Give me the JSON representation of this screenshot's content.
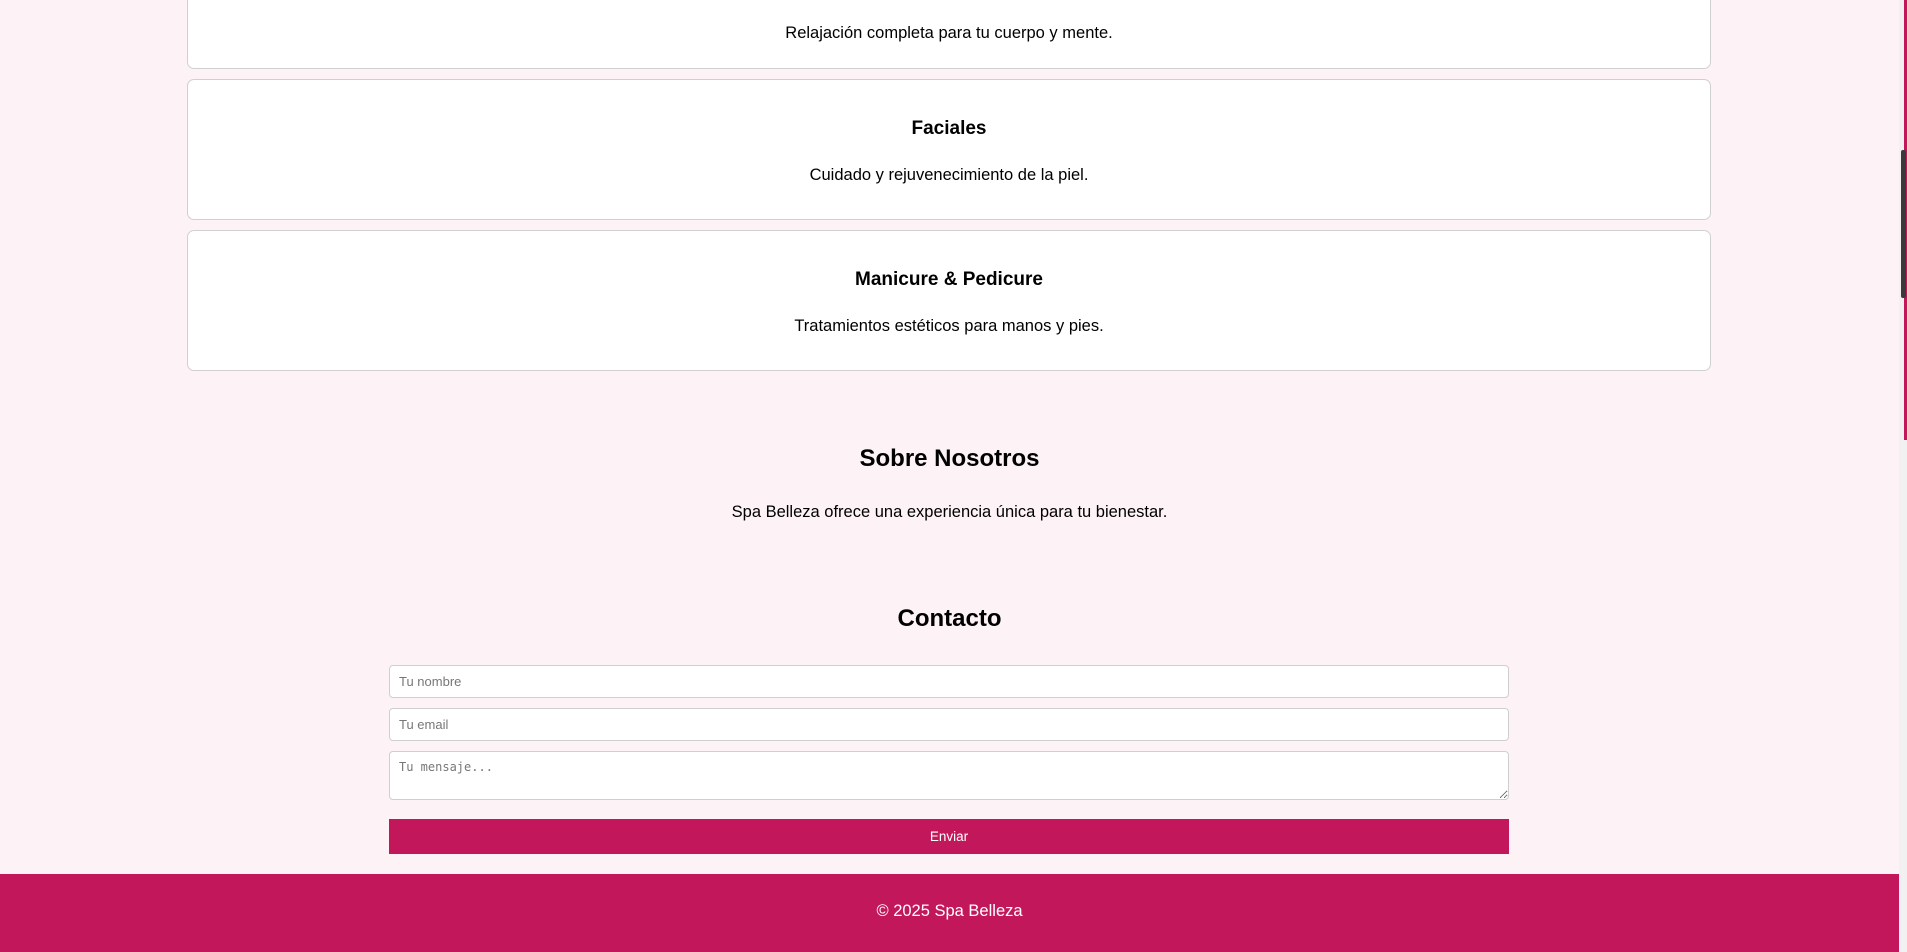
{
  "services": [
    {
      "title": "",
      "desc": "Relajación completa para tu cuerpo y mente."
    },
    {
      "title": "Faciales",
      "desc": "Cuidado y rejuvenecimiento de la piel."
    },
    {
      "title": "Manicure & Pedicure",
      "desc": "Tratamientos estéticos para manos y pies."
    }
  ],
  "about": {
    "title": "Sobre Nosotros",
    "text": "Spa Belleza ofrece una experiencia única para tu bienestar."
  },
  "contact": {
    "title": "Contacto",
    "name_placeholder": "Tu nombre",
    "email_placeholder": "Tu email",
    "message_placeholder": "Tu mensaje...",
    "submit_label": "Enviar"
  },
  "footer": {
    "text": "© 2025 Spa Belleza"
  },
  "colors": {
    "accent": "#c2185b",
    "background": "#fdf2f6",
    "card": "#ffffff"
  }
}
